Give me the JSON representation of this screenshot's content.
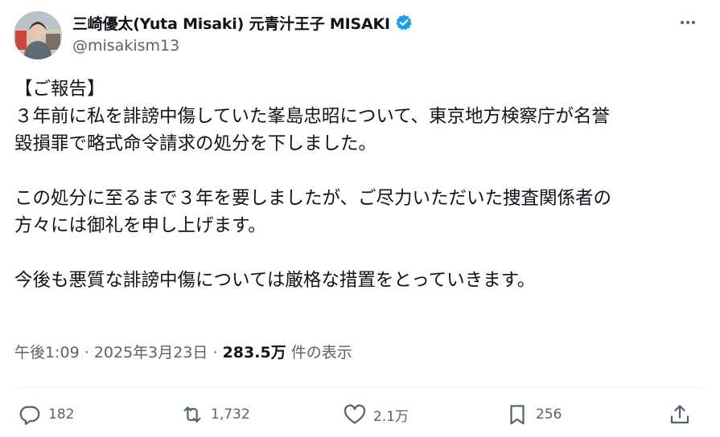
{
  "author": {
    "display_name": "三崎優太(Yuta Misaki) 元青汁王子 MISAKI",
    "handle": "@misakism13",
    "verified_icon": "verified-badge-icon",
    "accent_color": "#1d9bf0"
  },
  "post": {
    "lines": [
      "【ご報告】",
      "３年前に私を誹謗中傷していた峯島忠昭について、東京地方検察庁が名誉",
      "毀損罪で略式命令請求の処分を下しました。",
      "",
      "この処分に至るまで３年を要しましたが、ご尽力いただいた捜査関係者の",
      "方々には御礼を申し上げます。",
      "",
      "今後も悪質な誹謗中傷については厳格な措置をとっていきます。"
    ]
  },
  "meta": {
    "time": "午後1:09",
    "separator": "·",
    "date": "2025年3月23日",
    "views": "283.5万",
    "views_label": "件の表示"
  },
  "actions": {
    "replies": "182",
    "reposts": "1,732",
    "likes": "2.1万",
    "bookmarks": "256"
  }
}
